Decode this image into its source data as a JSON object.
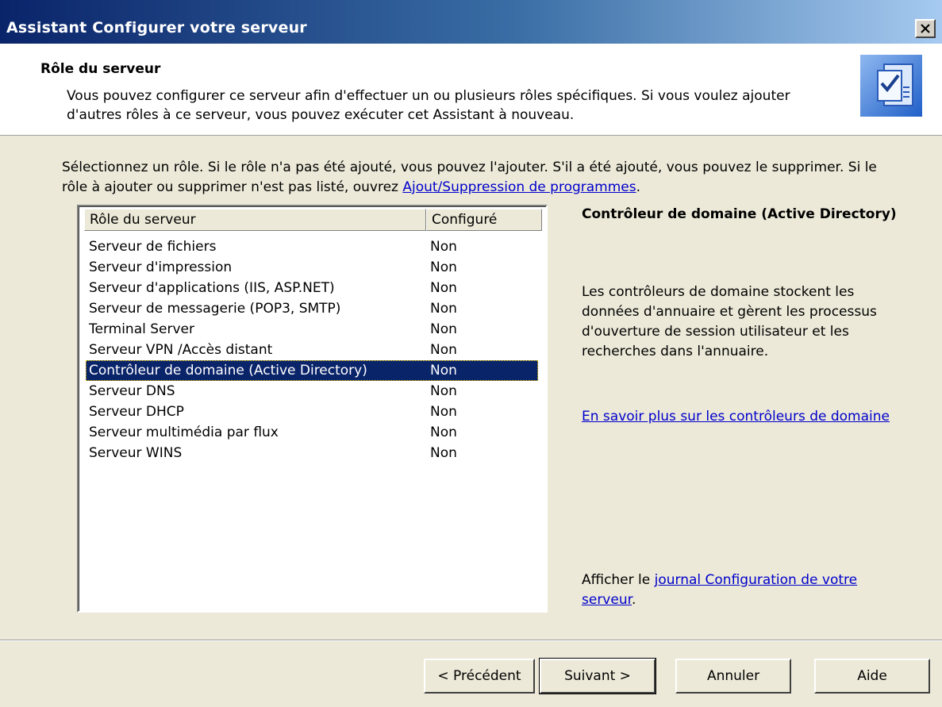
{
  "window": {
    "title": "Assistant Configurer votre serveur",
    "close_label": "✕"
  },
  "header": {
    "title": "Rôle du serveur",
    "description": "Vous pouvez configurer ce serveur afin d'effectuer un ou plusieurs rôles spécifiques. Si vous voulez ajouter d'autres rôles à ce serveur, vous pouvez exécuter cet Assistant à nouveau.",
    "icon": "wizard-checklist-icon"
  },
  "instructions": {
    "text": "Sélectionnez un rôle. Si le rôle n'a pas été ajouté, vous pouvez l'ajouter. S'il a été ajouté, vous pouvez le supprimer. Si le rôle à ajouter ou supprimer n'est pas listé, ouvrez ",
    "link": "Ajout/Suppression de programmes",
    "suffix": "."
  },
  "roles_table": {
    "columns": [
      "Rôle du serveur",
      "Configuré"
    ],
    "rows": [
      {
        "role": "Serveur de fichiers",
        "configured": "Non"
      },
      {
        "role": "Serveur d'impression",
        "configured": "Non"
      },
      {
        "role": "Serveur d'applications (IIS, ASP.NET)",
        "configured": "Non"
      },
      {
        "role": "Serveur de messagerie (POP3, SMTP)",
        "configured": "Non"
      },
      {
        "role": "Terminal Server",
        "configured": "Non"
      },
      {
        "role": "Serveur VPN /Accès distant",
        "configured": "Non"
      },
      {
        "role": "Contrôleur de domaine (Active Directory)",
        "configured": "Non"
      },
      {
        "role": "Serveur DNS",
        "configured": "Non"
      },
      {
        "role": "Serveur DHCP",
        "configured": "Non"
      },
      {
        "role": "Serveur multimédia par flux",
        "configured": "Non"
      },
      {
        "role": "Serveur WINS",
        "configured": "Non"
      }
    ],
    "selected_index": 6
  },
  "detail": {
    "title": "Contrôleur de domaine (Active Directory)",
    "description": "Les contrôleurs de domaine stockent les données d'annuaire et gèrent les processus d'ouverture de session utilisateur et les recherches dans l'annuaire.",
    "more_link": "En savoir plus sur les contrôleurs de domaine"
  },
  "log": {
    "prefix": "Afficher le ",
    "link": "journal Configuration de votre serveur",
    "suffix": "."
  },
  "buttons": {
    "back": "< Précédent",
    "next": "Suivant >",
    "cancel": "Annuler",
    "help": "Aide"
  },
  "colors": {
    "selection": "#0a246a",
    "link": "#0000cc",
    "dialog_bg": "#ece9d8"
  }
}
